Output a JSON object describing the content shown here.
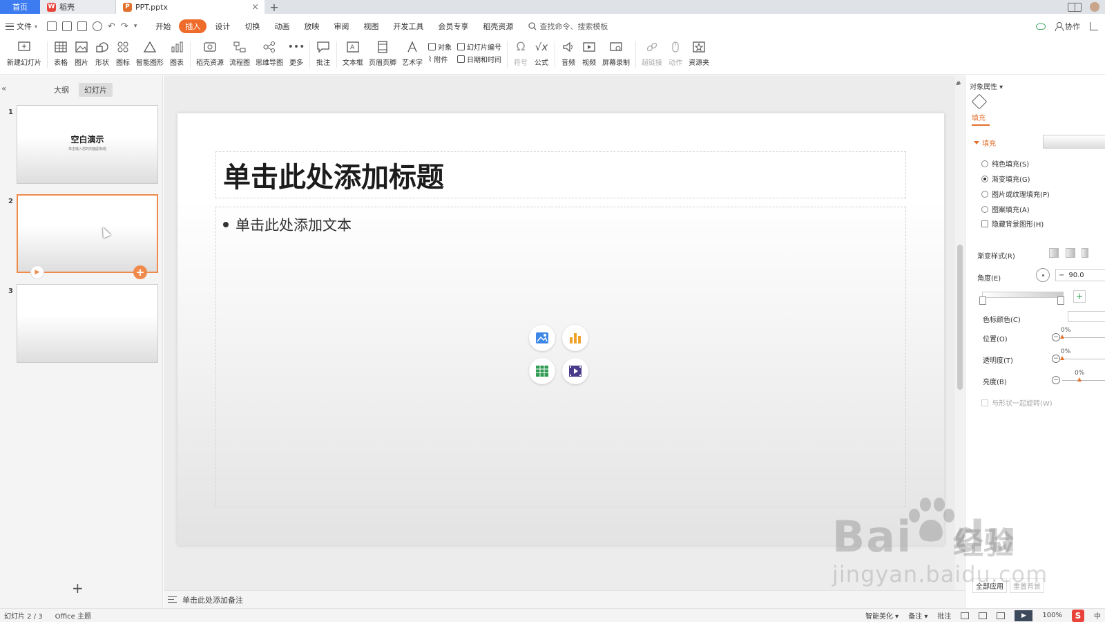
{
  "tabs": {
    "home": "首页",
    "doc_label": "稻壳",
    "active_file": "PPT.pptx"
  },
  "menu": {
    "file": "文件",
    "tabs": [
      "开始",
      "插入",
      "设计",
      "切换",
      "动画",
      "放映",
      "审阅",
      "视图",
      "开发工具",
      "会员专享",
      "稻壳资源"
    ],
    "active_index": 1,
    "search_placeholder": "查找命令、搜索模板",
    "collab": "协作"
  },
  "ribbon": {
    "new_slide": "新建幻灯片",
    "table": "表格",
    "picture": "图片",
    "shape": "形状",
    "icon": "图标",
    "smartart": "智能图形",
    "chart": "图表",
    "docer_res": "稻壳资源",
    "flowchart": "流程图",
    "mindmap": "思维导图",
    "more": "更多",
    "comment": "批注",
    "textbox": "文本框",
    "header_footer": "页眉页脚",
    "wordart": "艺术字",
    "object": "对象",
    "attachment": "附件",
    "slide_number": "幻灯片编号",
    "datetime": "日期和时间",
    "symbol": "符号",
    "formula": "公式",
    "audio": "音频",
    "video": "视频",
    "screen_record": "屏幕录制",
    "hyperlink": "超链接",
    "action": "动作",
    "resource_folder": "资源夹"
  },
  "left_panel": {
    "tab_outline": "大纲",
    "tab_slides": "幻灯片",
    "slides": [
      {
        "num": "1",
        "title": "空白演示",
        "subtitle": "单击输入您的封面副标题"
      },
      {
        "num": "2"
      },
      {
        "num": "3"
      }
    ],
    "selected_index": 1
  },
  "slide": {
    "title_placeholder": "单击此处添加标题",
    "body_placeholder": "单击此处添加文本"
  },
  "notes": {
    "placeholder": "单击此处添加备注"
  },
  "right_panel": {
    "header": "对象属性",
    "tab_fill": "填充",
    "section_fill": "填充",
    "options": {
      "solid": "纯色填充(S)",
      "gradient": "渐变填充(G)",
      "picture": "图片或纹理填充(P)",
      "pattern": "图案填充(A)",
      "hide_bg": "隐藏背景图形(H)"
    },
    "selected_option": "gradient",
    "gradient_style": "渐变样式(R)",
    "angle_label": "角度(E)",
    "angle_value": "90.0",
    "stop_color": "色标颜色(C)",
    "position": "位置(O)",
    "position_value": "0%",
    "transparency": "透明度(T)",
    "transparency_value": "0%",
    "brightness": "亮度(B)",
    "brightness_value": "0%",
    "rotate_with_shape": "与形状一起旋转(W)",
    "apply_all": "全部应用",
    "reset_bg": "重置背景"
  },
  "status": {
    "slide_count": "幻灯片 2 / 3",
    "theme": "Office 主题",
    "beautify": "智能美化",
    "notes": "备注",
    "comments": "批注",
    "zoom": "100%",
    "ime": "中"
  },
  "watermark": {
    "brand": "Bai",
    "brand_tail": "du",
    "cn": "经验",
    "url": "jingyan.baidu.com"
  },
  "colors": {
    "accent": "#ee6b2a",
    "home_tab": "#3c7cf0"
  }
}
